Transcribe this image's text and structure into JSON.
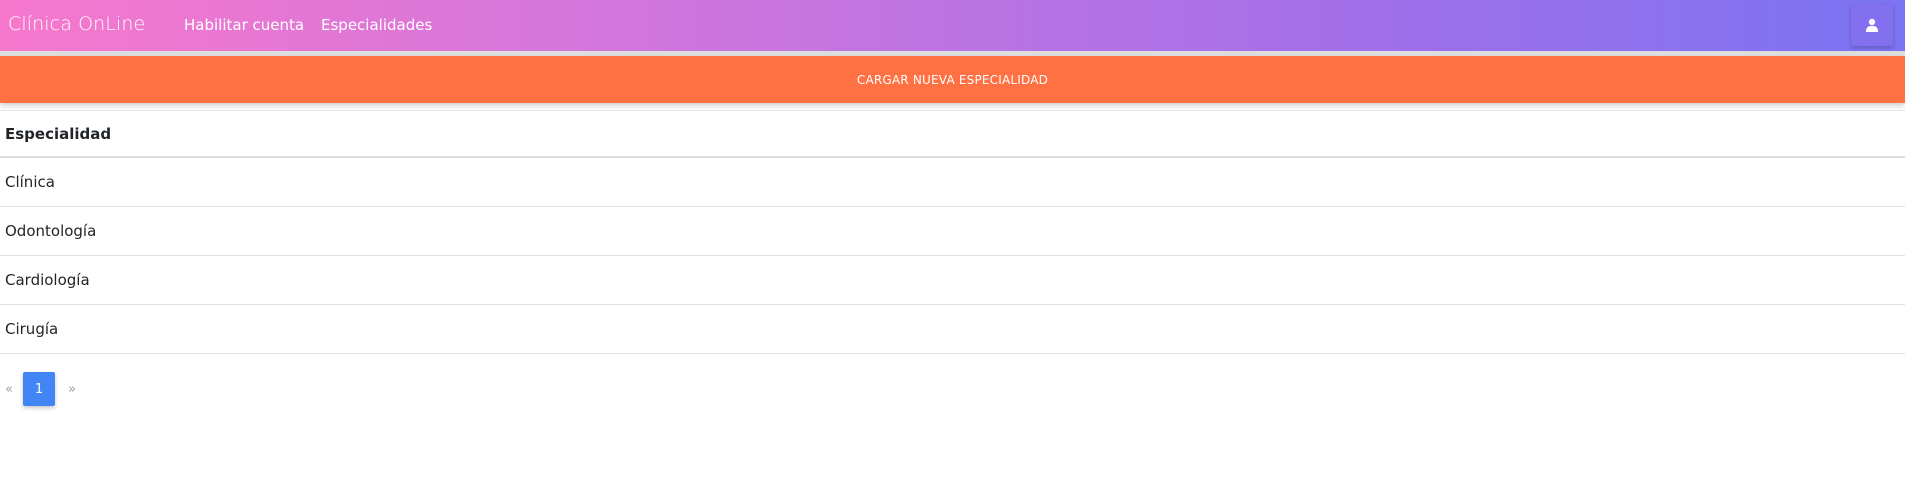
{
  "navbar": {
    "brand": "Clínica OnLine",
    "links": [
      "Habilitar cuenta",
      "Especialidades"
    ],
    "user_icon": "user-icon",
    "gradient": [
      "#f678cd",
      "#7b74f3"
    ]
  },
  "cta": {
    "label": "CARGAR NUEVA ESPECIALIDAD",
    "color": "#ff7043"
  },
  "table": {
    "header": "Especialidad",
    "rows": [
      "Clínica",
      "Odontología",
      "Cardiología",
      "Cirugía"
    ]
  },
  "pagination": {
    "prev": "«",
    "current": "1",
    "next": "»",
    "active_color": "#4285f4"
  }
}
